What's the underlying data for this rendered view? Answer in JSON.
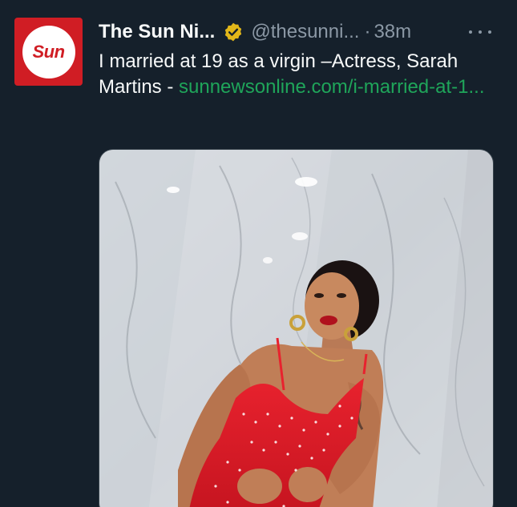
{
  "tweet": {
    "author": {
      "display_name": "The Sun Ni...",
      "handle": "@thesunni...",
      "avatar_logo": "Sun",
      "verified": true
    },
    "separator": "·",
    "timestamp": "38m",
    "text": "I married at 19 as a virgin –Actress, Sarah Martins - ",
    "link_text": "sunnewsonline.com/i-married-at-1...",
    "media": {
      "type": "photo"
    }
  },
  "colors": {
    "background": "#15202b",
    "text_primary": "#f7f9f9",
    "text_secondary": "#8b98a5",
    "link": "#1fa55a",
    "avatar_brand": "#d01d24",
    "verified_gold": "#e2b719"
  },
  "icons": {
    "verified": "verified-badge-icon",
    "more": "more-options-icon"
  }
}
